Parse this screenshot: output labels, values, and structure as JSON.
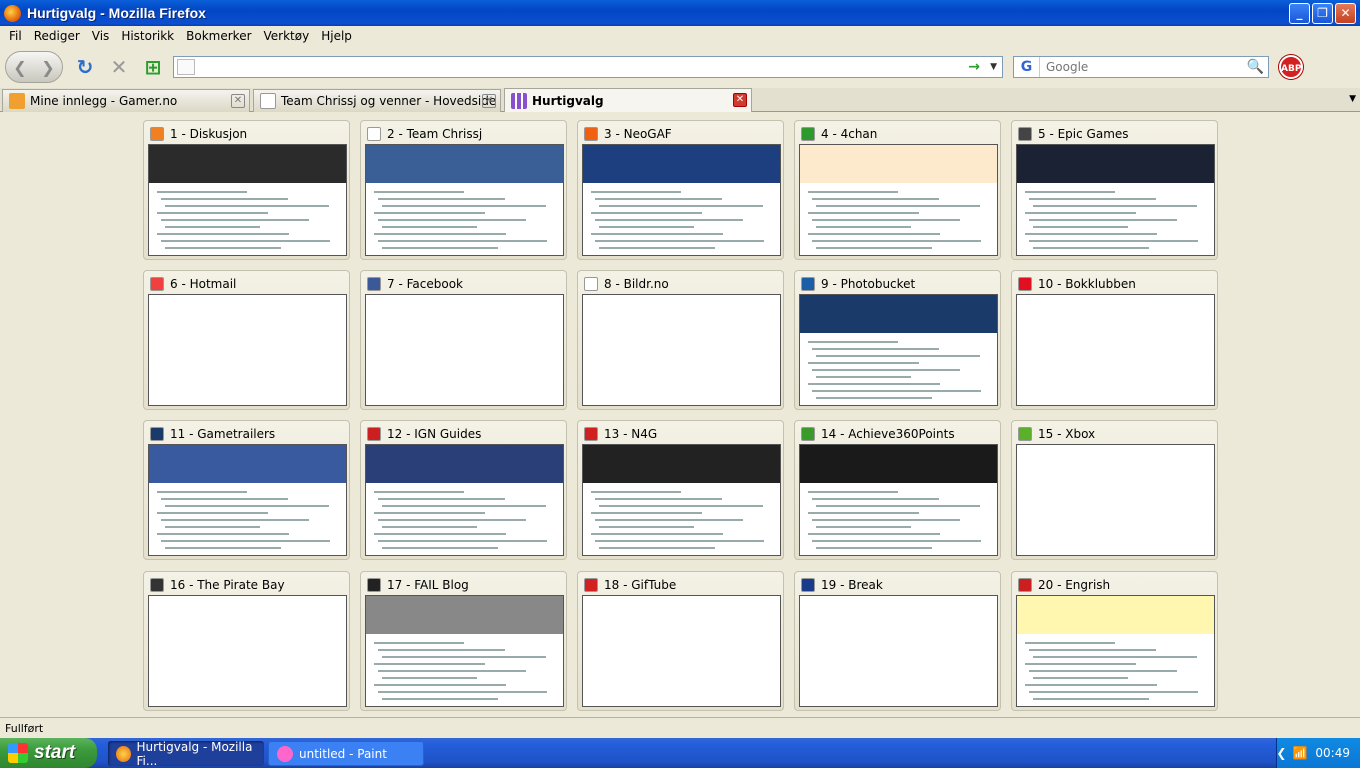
{
  "window": {
    "title": "Hurtigvalg - Mozilla Firefox"
  },
  "menu": [
    "Fil",
    "Rediger",
    "Vis",
    "Historikk",
    "Bokmerker",
    "Verktøy",
    "Hjelp"
  ],
  "navbar": {
    "url_value": "",
    "search_placeholder": "Google",
    "search_engine": "G",
    "abp_label": "ABP"
  },
  "tabs": [
    {
      "label": "Mine innlegg - Gamer.no",
      "color": "#f0a030"
    },
    {
      "label": "Team Chrissj og venner - Hovedside",
      "color": "#ffffff"
    },
    {
      "label": "Hurtigvalg",
      "color": "#8a4fcf",
      "active": true
    }
  ],
  "speeddial": [
    {
      "title": "1 - Diskusjon",
      "color": "#f08020",
      "bg": "#2b2b2b"
    },
    {
      "title": "2 - Team Chrissj",
      "color": "#ffffff",
      "bg": "#3a5e96"
    },
    {
      "title": "3 - NeoGAF",
      "color": "#f06010",
      "bg": "#1d3f80"
    },
    {
      "title": "4 - 4chan",
      "color": "#2e9a2e",
      "bg": "#fde9cc"
    },
    {
      "title": "5 - Epic Games",
      "color": "#444444",
      "bg": "#1a2233"
    },
    {
      "title": "6 - Hotmail",
      "color": "#f04040",
      "bg": "#ffffff"
    },
    {
      "title": "7 - Facebook",
      "color": "#3b5998",
      "bg": "#ffffff"
    },
    {
      "title": "8 - Bildr.no",
      "color": "#ffffff",
      "bg": "#ffffff"
    },
    {
      "title": "9 - Photobucket",
      "color": "#1a5fa8",
      "bg": "#1a3a6a"
    },
    {
      "title": "10 - Bokklubben",
      "color": "#e01020",
      "bg": "#ffffff"
    },
    {
      "title": "11 - Gametrailers",
      "color": "#1a3a6a",
      "bg": "#3a5aa0"
    },
    {
      "title": "12 - IGN Guides",
      "color": "#cc2020",
      "bg": "#2a3f78"
    },
    {
      "title": "13 - N4G",
      "color": "#d02020",
      "bg": "#222222"
    },
    {
      "title": "14 - Achieve360Points",
      "color": "#3a9a2a",
      "bg": "#1a1a1a"
    },
    {
      "title": "15 - Xbox",
      "color": "#5ab02a",
      "bg": "#ffffff"
    },
    {
      "title": "16 - The Pirate Bay",
      "color": "#333333",
      "bg": "#ffffff"
    },
    {
      "title": "17 - FAIL Blog",
      "color": "#222222",
      "bg": "#888888"
    },
    {
      "title": "18 - GifTube",
      "color": "#d02020",
      "bg": "#ffffff"
    },
    {
      "title": "19 - Break",
      "color": "#1a3a8a",
      "bg": "#ffffff"
    },
    {
      "title": "20 - Engrish",
      "color": "#cc2020",
      "bg": "#fff6b0"
    }
  ],
  "status": "Fullført",
  "taskbar": {
    "start": "start",
    "tasks": [
      {
        "label": "Hurtigvalg - Mozilla Fi...",
        "active": true
      },
      {
        "label": "untitled - Paint",
        "active": false
      }
    ],
    "clock": "00:49"
  }
}
